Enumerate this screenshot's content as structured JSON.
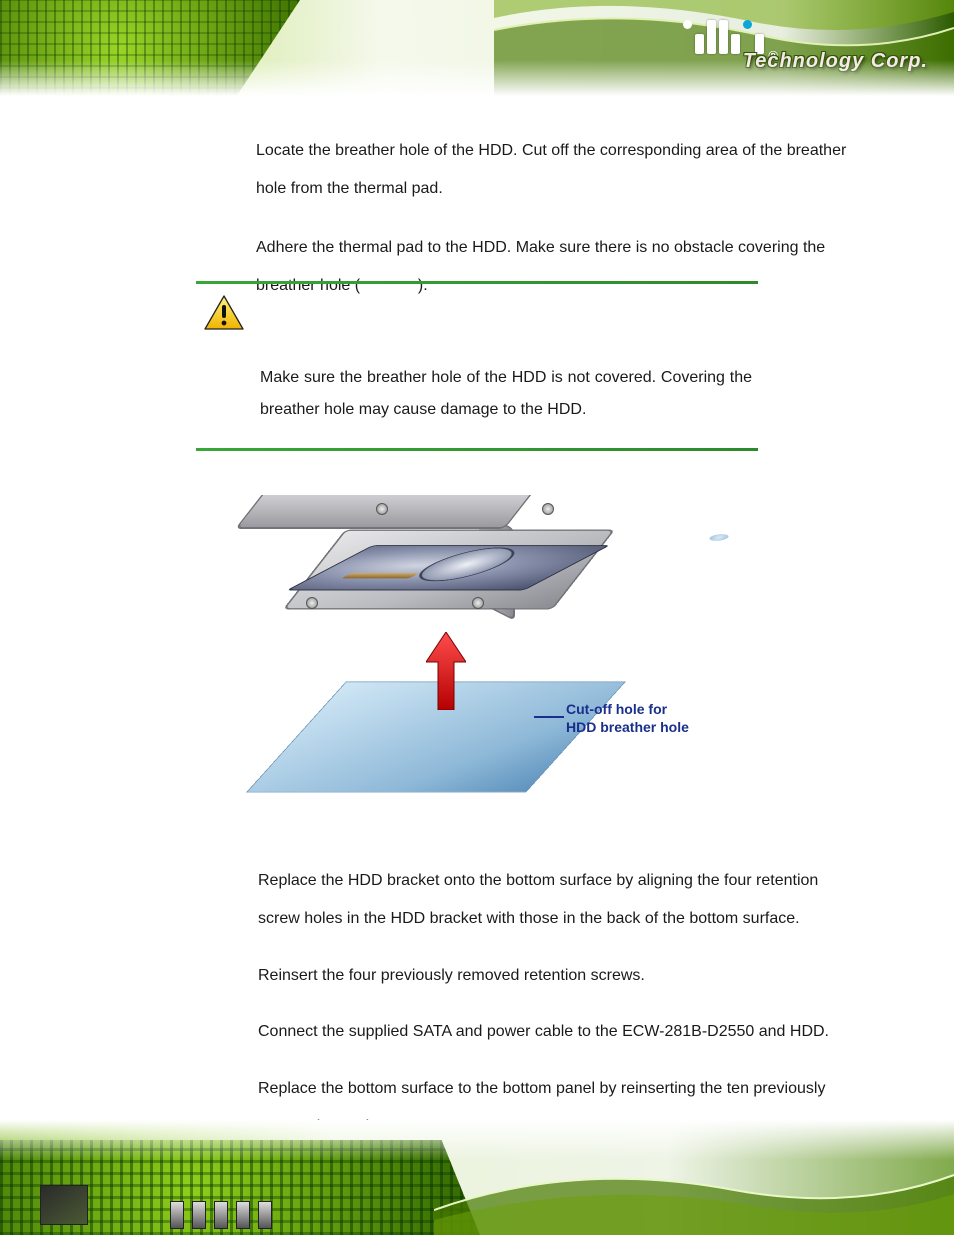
{
  "header": {
    "brand_registered": "®",
    "brand_text": "Technology Corp."
  },
  "steps": {
    "s1": "Locate the breather hole of the HDD. Cut off the corresponding area of the breather hole from the thermal pad.",
    "s2a": "Adhere the thermal pad to the HDD. Make sure there is no obstacle covering the breather hole (",
    "s2b": ").",
    "warning": "Make sure the breather hole of the HDD is not covered. Covering the breather hole may cause damage to the HDD.",
    "figure_label_line1": "Cut-off hole for",
    "figure_label_line2": "HDD breather hole",
    "s3": "Replace the HDD bracket onto the bottom surface by aligning the four retention screw holes in the HDD bracket with those in the back of the bottom surface.",
    "s4": "Reinsert the four previously removed retention screws.",
    "s5": "Connect the supplied SATA and power cable to the ECW-281B-D2550 and HDD.",
    "s6": "Replace the bottom surface to the bottom panel by reinserting the ten previously removed retention screws."
  }
}
